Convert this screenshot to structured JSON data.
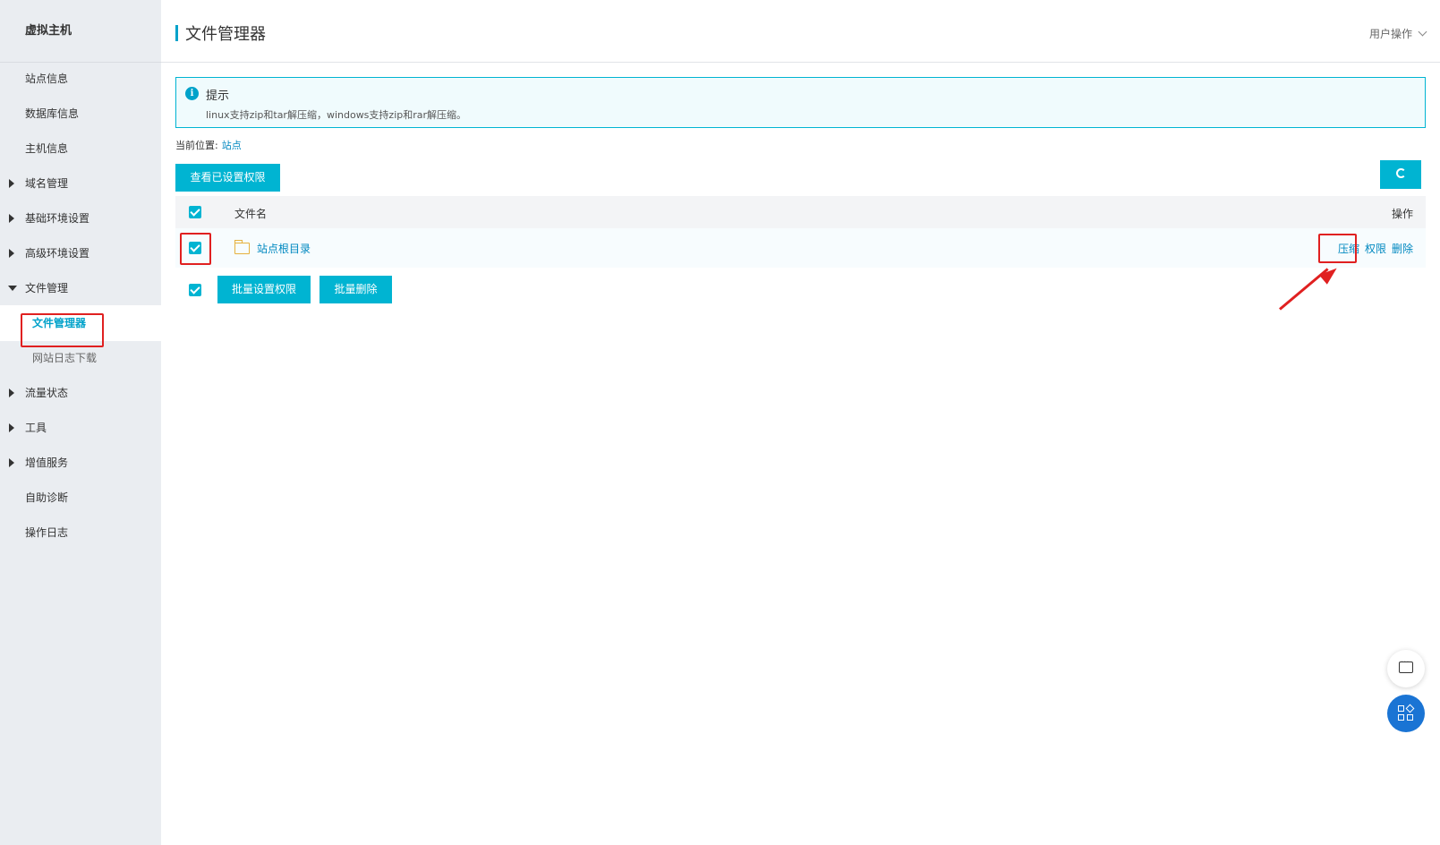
{
  "sidebar": {
    "title": "虚拟主机",
    "items": [
      {
        "label": "站点信息"
      },
      {
        "label": "数据库信息"
      },
      {
        "label": "主机信息"
      },
      {
        "label": "域名管理"
      },
      {
        "label": "基础环境设置"
      },
      {
        "label": "高级环境设置"
      },
      {
        "label": "文件管理"
      },
      {
        "label": "文件管理器"
      },
      {
        "label": "网站日志下载"
      },
      {
        "label": "流量状态"
      },
      {
        "label": "工具"
      },
      {
        "label": "增值服务"
      },
      {
        "label": "自助诊断"
      },
      {
        "label": "操作日志"
      }
    ]
  },
  "header": {
    "title": "文件管理器",
    "user_ops": "用户操作"
  },
  "tip": {
    "title": "提示",
    "text": "linux支持zip和tar解压缩，windows支持zip和rar解压缩。",
    "icon": "info-icon"
  },
  "breadcrumb": {
    "label": "当前位置:",
    "current": "站点"
  },
  "toolbar": {
    "view_permissions": "查看已设置权限",
    "refresh_icon": "refresh-icon"
  },
  "table": {
    "col_name": "文件名",
    "col_ops": "操作",
    "rows": [
      {
        "name": "站点根目录",
        "ops": [
          "压缩",
          "权限",
          "删除"
        ]
      }
    ]
  },
  "batch": {
    "set_permissions": "批量设置权限",
    "delete": "批量删除"
  },
  "colors": {
    "accent": "#00b4d2",
    "link": "#0088c0",
    "highlight": "#e02020",
    "sidebar_bg": "#eaedf1"
  }
}
